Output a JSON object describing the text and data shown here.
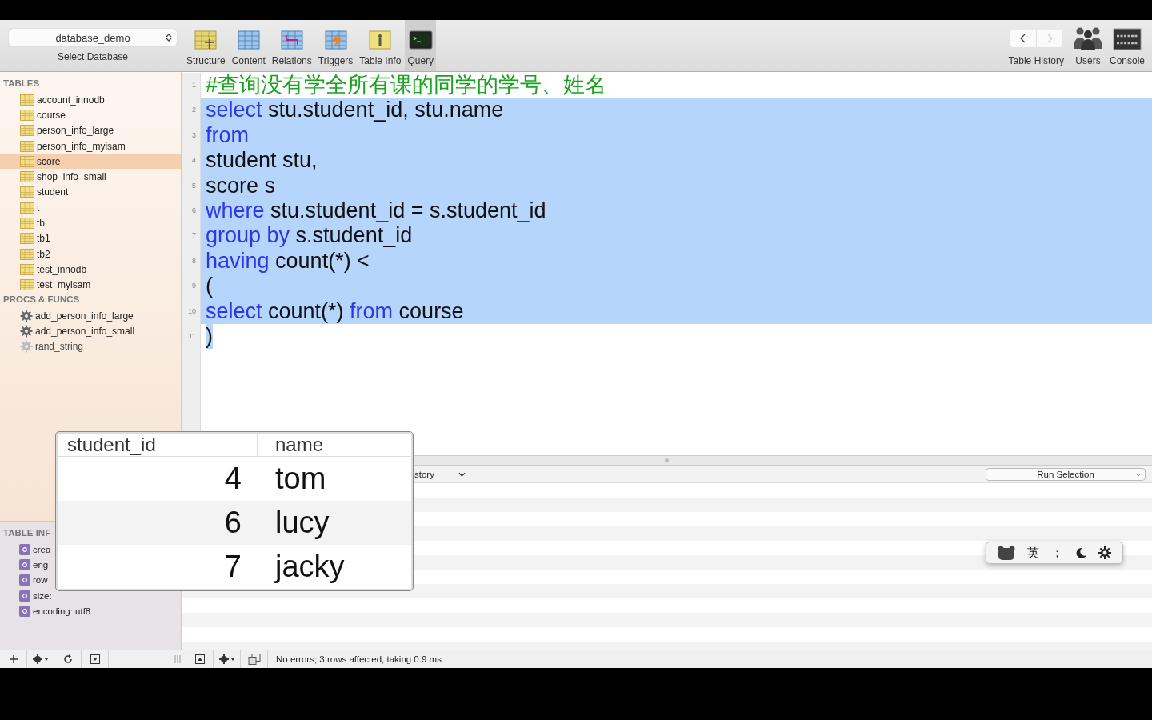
{
  "toolbar": {
    "database": {
      "value": "database_demo",
      "label": "Select Database"
    },
    "tools": [
      {
        "label": "Structure",
        "kind": "structure",
        "selected": false
      },
      {
        "label": "Content",
        "kind": "content",
        "selected": false
      },
      {
        "label": "Relations",
        "kind": "relations",
        "selected": false
      },
      {
        "label": "Triggers",
        "kind": "triggers",
        "selected": false
      },
      {
        "label": "Table Info",
        "kind": "info",
        "selected": false
      },
      {
        "label": "Query",
        "kind": "query",
        "selected": true
      }
    ],
    "history": {
      "label": "Table History",
      "back_disabled": false,
      "forward_disabled": true
    },
    "right_tools": [
      {
        "label": "Users",
        "kind": "users"
      },
      {
        "label": "Console",
        "kind": "console"
      }
    ]
  },
  "sidebar": {
    "sections": [
      {
        "title": "TABLES",
        "kind": "table",
        "items": [
          {
            "name": "account_innodb",
            "selected": false
          },
          {
            "name": "course",
            "selected": false
          },
          {
            "name": "person_info_large",
            "selected": false
          },
          {
            "name": "person_info_myisam",
            "selected": false
          },
          {
            "name": "score",
            "selected": true
          },
          {
            "name": "shop_info_small",
            "selected": false
          },
          {
            "name": "student",
            "selected": false
          },
          {
            "name": "t",
            "selected": false
          },
          {
            "name": "tb",
            "selected": false
          },
          {
            "name": "tb1",
            "selected": false
          },
          {
            "name": "tb2",
            "selected": false
          },
          {
            "name": "test_innodb",
            "selected": false
          },
          {
            "name": "test_myisam",
            "selected": false
          }
        ]
      },
      {
        "title": "PROCS & FUNCS",
        "kind": "proc",
        "items": [
          {
            "name": "add_person_info_large",
            "selected": false,
            "disabled": false
          },
          {
            "name": "add_person_info_small",
            "selected": false,
            "disabled": false
          },
          {
            "name": "rand_string",
            "selected": false,
            "disabled": true
          }
        ]
      }
    ],
    "table_info": {
      "title": "TABLE INF",
      "items": [
        "crea",
        "eng",
        "row",
        "size:",
        "encoding: utf8"
      ]
    }
  },
  "editor": {
    "lines": [
      {
        "number": "1",
        "selected": false,
        "segments": [
          {
            "text": "#查询没有学全所有课的同学的学号、姓名",
            "kind": "comment"
          }
        ]
      },
      {
        "number": "2",
        "selected": true,
        "segments": [
          {
            "text": "select",
            "kind": "keyword"
          },
          {
            "text": " stu.student_id, stu.name",
            "kind": "plain"
          }
        ]
      },
      {
        "number": "3",
        "selected": true,
        "segments": [
          {
            "text": "from",
            "kind": "keyword"
          }
        ]
      },
      {
        "number": "4",
        "selected": true,
        "segments": [
          {
            "text": "student stu,",
            "kind": "plain"
          }
        ]
      },
      {
        "number": "5",
        "selected": true,
        "segments": [
          {
            "text": "score s",
            "kind": "plain"
          }
        ]
      },
      {
        "number": "6",
        "selected": true,
        "segments": [
          {
            "text": "where",
            "kind": "keyword"
          },
          {
            "text": " stu.student_id = s.student_id",
            "kind": "plain"
          }
        ]
      },
      {
        "number": "7",
        "selected": true,
        "segments": [
          {
            "text": "group by",
            "kind": "keyword"
          },
          {
            "text": " s.student_id",
            "kind": "plain"
          }
        ]
      },
      {
        "number": "8",
        "selected": true,
        "segments": [
          {
            "text": "having",
            "kind": "keyword"
          },
          {
            "text": " count(*) <",
            "kind": "plain"
          }
        ]
      },
      {
        "number": "9",
        "selected": true,
        "segments": [
          {
            "text": "(",
            "kind": "plain"
          }
        ]
      },
      {
        "number": "10",
        "selected": true,
        "segments": [
          {
            "text": "select",
            "kind": "keyword"
          },
          {
            "text": " count(*) ",
            "kind": "plain"
          },
          {
            "text": "from",
            "kind": "keyword"
          },
          {
            "text": " course",
            "kind": "plain"
          }
        ]
      },
      {
        "number": "11",
        "selected": true,
        "segments": [
          {
            "text": ")",
            "kind": "plain"
          }
        ]
      }
    ]
  },
  "results_bar": {
    "history_dropdown": "story",
    "run_button": "Run Selection"
  },
  "popup": {
    "columns": [
      "student_id",
      "name"
    ],
    "rows": [
      [
        "4",
        "tom"
      ],
      [
        "6",
        "lucy"
      ],
      [
        "7",
        "jacky"
      ]
    ]
  },
  "ime_bar": {
    "items": [
      {
        "kind": "logo"
      },
      {
        "kind": "text",
        "text": "英"
      },
      {
        "kind": "text",
        "text": "；"
      },
      {
        "kind": "moon"
      },
      {
        "kind": "gear"
      }
    ]
  },
  "status_bar": {
    "message": "No errors; 3 rows affected, taking 0.9 ms"
  }
}
